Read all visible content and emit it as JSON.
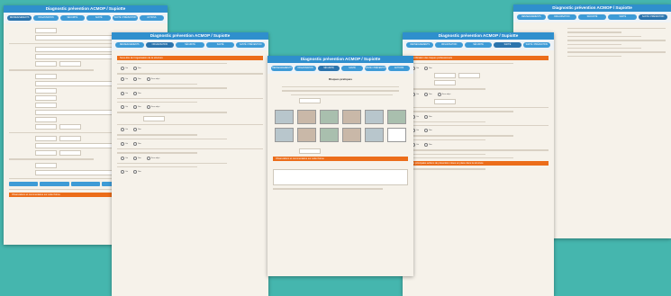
{
  "app_title": "Diagnostic prévention ACMOP / Supiotte",
  "tabs": [
    "RENSEIGNEMENTS",
    "ORGANISATION",
    "SÉCURITÉ",
    "SANTÉ",
    "SANTÉ / PRÉVENTION",
    "ACTIONS"
  ],
  "sections": {
    "organisation": "Sous-titre de l'organisation de la structure",
    "commentaires": "Observations et commentaires sur cette thème",
    "indicateurs": "Identification des risques professionnels",
    "prevention": "Les principales actions de prévention mises en place dans la structure"
  },
  "photo_heading": "Risques pratiques",
  "options": {
    "yes": "Oui",
    "no": "Non",
    "na": "Sans objet"
  }
}
